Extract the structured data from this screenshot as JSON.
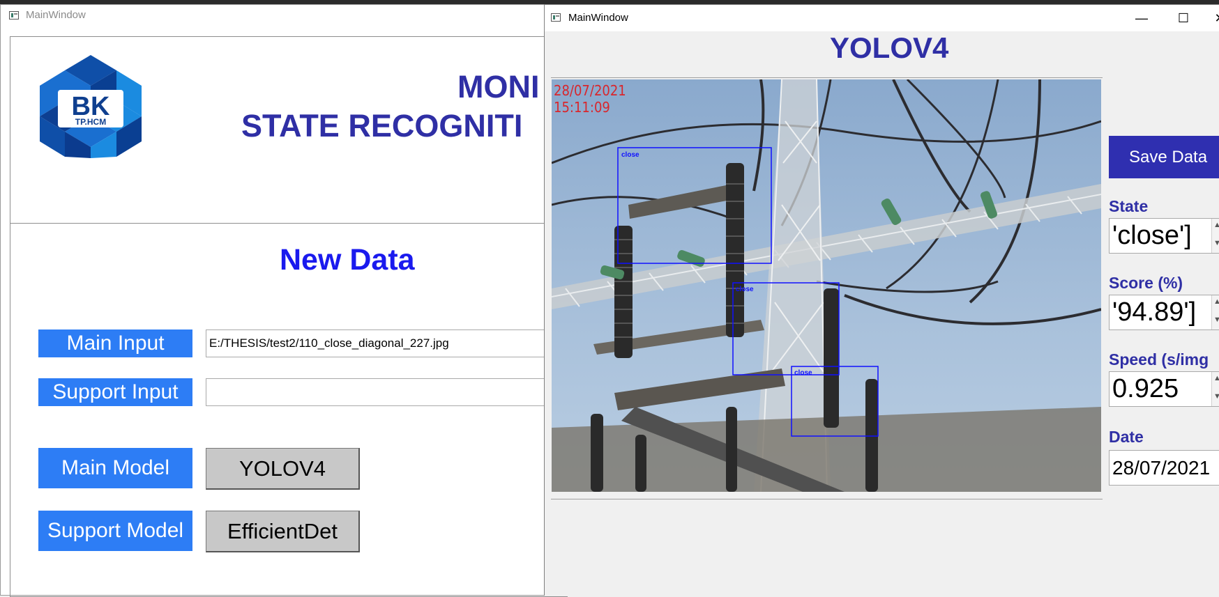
{
  "back_window": {
    "title": "MainWindow",
    "logo_text": "BK",
    "logo_subtext": "TP.HCM",
    "header_line1": "MONI",
    "header_line2": "STATE RECOGNITI",
    "section_title": "New Data",
    "main_input_label": "Main Input",
    "main_input_value": "E:/THESIS/test2/110_close_diagonal_227.jpg",
    "support_input_label": "Support Input",
    "support_input_value": "",
    "main_model_label": "Main Model",
    "main_model_value": "YOLOV4",
    "support_model_label": "Support Model",
    "support_model_value": "EfficientDet"
  },
  "front_window": {
    "title": "MainWindow",
    "controls": {
      "minimize": "—",
      "maximize": "☐",
      "close": "✕"
    },
    "model_title": "YOLOV4",
    "image": {
      "date_stamp": "28/07/2021",
      "time_stamp": "15:11:09",
      "detections": [
        {
          "label": "close"
        },
        {
          "label": "close"
        },
        {
          "label": "close"
        }
      ]
    },
    "save_button": "Save Data",
    "state_label": "State",
    "state_value": "'close']",
    "score_label": "Score (%)",
    "score_value": "'94.89']",
    "speed_label": "Speed (s/img",
    "speed_value": "0.925",
    "date_label": "Date",
    "date_value": "28/07/2021"
  },
  "colors": {
    "label_blue": "#2d7df5",
    "title_navy": "#2f2fa5",
    "new_data_blue": "#1a1aee",
    "save_button_bg": "#2f2fb0",
    "stamp_red": "#d8262c",
    "detection_box": "#1010ff"
  }
}
